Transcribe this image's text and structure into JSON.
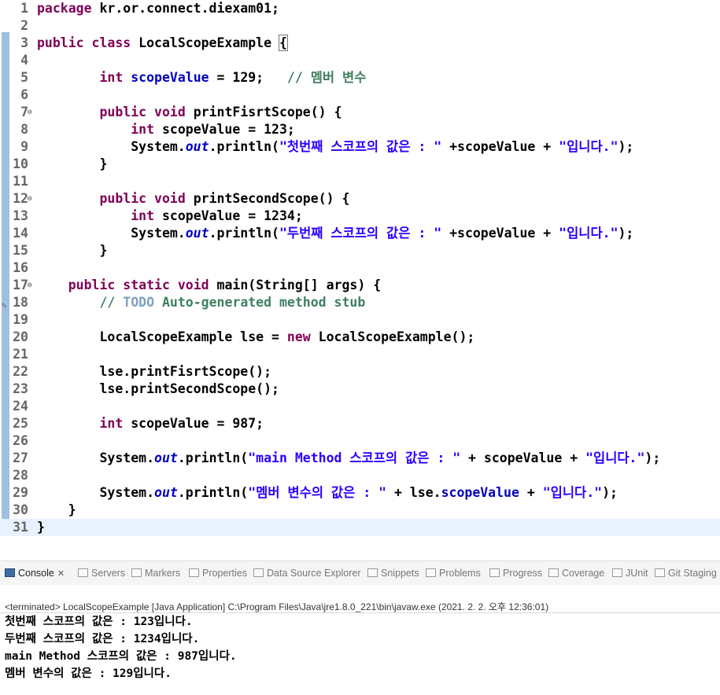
{
  "editor": {
    "lines": [
      {
        "n": "1",
        "html": "<span class=\"kw\">package</span> kr.or.connect.diexam01;"
      },
      {
        "n": "2",
        "html": ""
      },
      {
        "n": "3",
        "html": "<span class=\"kw\">public</span> <span class=\"kw\">class</span> LocalScopeExample <span class=\"bracket\">{</span>"
      },
      {
        "n": "4",
        "html": ""
      },
      {
        "n": "5",
        "html": "        <span class=\"kw\">int</span> <span class=\"fld\">scopeValue</span> = 129;   <span class=\"cm\">// 멤버 변수</span>"
      },
      {
        "n": "6",
        "html": ""
      },
      {
        "n": "7",
        "html": "        <span class=\"kw\">public</span> <span class=\"kw\">void</span> printFisrtScope() {",
        "fold": true
      },
      {
        "n": "8",
        "html": "            <span class=\"kw\">int</span> scopeValue = 123;"
      },
      {
        "n": "9",
        "html": "            System.<span class=\"stat\">out</span>.println(<span class=\"str\">\"첫번째 스코프의 값은 : \"</span> +scopeValue + <span class=\"str\">\"입니다.\"</span>);"
      },
      {
        "n": "10",
        "html": "        }"
      },
      {
        "n": "11",
        "html": ""
      },
      {
        "n": "12",
        "html": "        <span class=\"kw\">public</span> <span class=\"kw\">void</span> printSecondScope() {",
        "fold": true
      },
      {
        "n": "13",
        "html": "            <span class=\"kw\">int</span> scopeValue = 1234;"
      },
      {
        "n": "14",
        "html": "            System.<span class=\"stat\">out</span>.println(<span class=\"str\">\"두번째 스코프의 값은 : \"</span> +scopeValue + <span class=\"str\">\"입니다.\"</span>);"
      },
      {
        "n": "15",
        "html": "        }"
      },
      {
        "n": "16",
        "html": ""
      },
      {
        "n": "17",
        "html": "    <span class=\"kw\">public</span> <span class=\"kw\">static</span> <span class=\"kw\">void</span> main(String[] args) {",
        "fold": true
      },
      {
        "n": "18",
        "html": "        <span class=\"cm\">// <span class=\"todo\">TODO</span> Auto-generated method stub</span>",
        "warn": true
      },
      {
        "n": "19",
        "html": ""
      },
      {
        "n": "20",
        "html": "        LocalScopeExample lse = <span class=\"kw\">new</span> LocalScopeExample();"
      },
      {
        "n": "21",
        "html": ""
      },
      {
        "n": "22",
        "html": "        lse.printFisrtScope();"
      },
      {
        "n": "23",
        "html": "        lse.printSecondScope();"
      },
      {
        "n": "24",
        "html": ""
      },
      {
        "n": "25",
        "html": "        <span class=\"kw\">int</span> scopeValue = 987;"
      },
      {
        "n": "26",
        "html": ""
      },
      {
        "n": "27",
        "html": "        System.<span class=\"stat\">out</span>.println(<span class=\"str\">\"main Method 스코프의 값은 : \"</span> + scopeValue + <span class=\"str\">\"입니다.\"</span>);"
      },
      {
        "n": "28",
        "html": ""
      },
      {
        "n": "29",
        "html": "        System.<span class=\"stat\">out</span>.println(<span class=\"str\">\"멤버 변수의 값은 : \"</span> + lse.<span class=\"fld\">scopeValue</span> + <span class=\"str\">\"입니다.\"</span>);"
      },
      {
        "n": "30",
        "html": "    }"
      },
      {
        "n": "31",
        "html": "}",
        "current": true
      }
    ],
    "scroll_left_arrow": "<"
  },
  "tabs": [
    {
      "label": "Console",
      "active": true,
      "icon": "console-icon"
    },
    {
      "label": "Servers",
      "icon": "servers-icon"
    },
    {
      "label": "Markers",
      "icon": "markers-icon"
    },
    {
      "label": "Properties",
      "icon": "properties-icon"
    },
    {
      "label": "Data Source Explorer",
      "icon": "data-source-icon"
    },
    {
      "label": "Snippets",
      "icon": "snippets-icon"
    },
    {
      "label": "Problems",
      "icon": "problems-icon"
    },
    {
      "label": "Progress",
      "icon": "progress-icon"
    },
    {
      "label": "Coverage",
      "icon": "coverage-icon"
    },
    {
      "label": "JUnit",
      "icon": "junit-icon"
    },
    {
      "label": "Git Staging",
      "icon": "git-staging-icon"
    }
  ],
  "tab_close": "✕",
  "console": {
    "status": "<terminated> LocalScopeExample [Java Application] C:\\Program Files\\Java\\jre1.8.0_221\\bin\\javaw.exe (2021. 2. 2. 오후 12:36:01)",
    "output": [
      "첫번째 스코프의 값은 : 123입니다.",
      "두번째 스코프의 값은 : 1234입니다.",
      "main Method 스코프의 값은 : 987입니다.",
      "멤버 변수의 값은 : 129입니다."
    ]
  }
}
